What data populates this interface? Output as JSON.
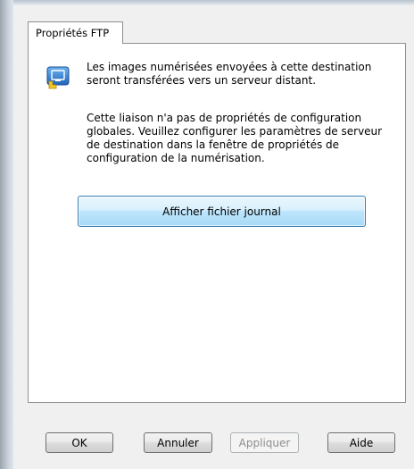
{
  "tab": {
    "label": "Propriétés FTP"
  },
  "panel": {
    "description": "Les images numérisées envoyées à cette destination seront transférées vers un serveur distant.",
    "info": "Cette liaison n'a pas de propriétés de configuration globales. Veuillez configurer les paramètres de serveur de destination dans la fenêtre de propriétés de configuration de la numérisation.",
    "log_button": "Afficher fichier journal",
    "icon": "ftp-destination-icon"
  },
  "buttons": {
    "ok": "OK",
    "cancel": "Annuler",
    "apply": "Appliquer",
    "help": "Aide"
  },
  "colors": {
    "accent_button": "#bee6fd",
    "icon_blue": "#2f7fd8",
    "icon_yellow": "#f2c428"
  }
}
